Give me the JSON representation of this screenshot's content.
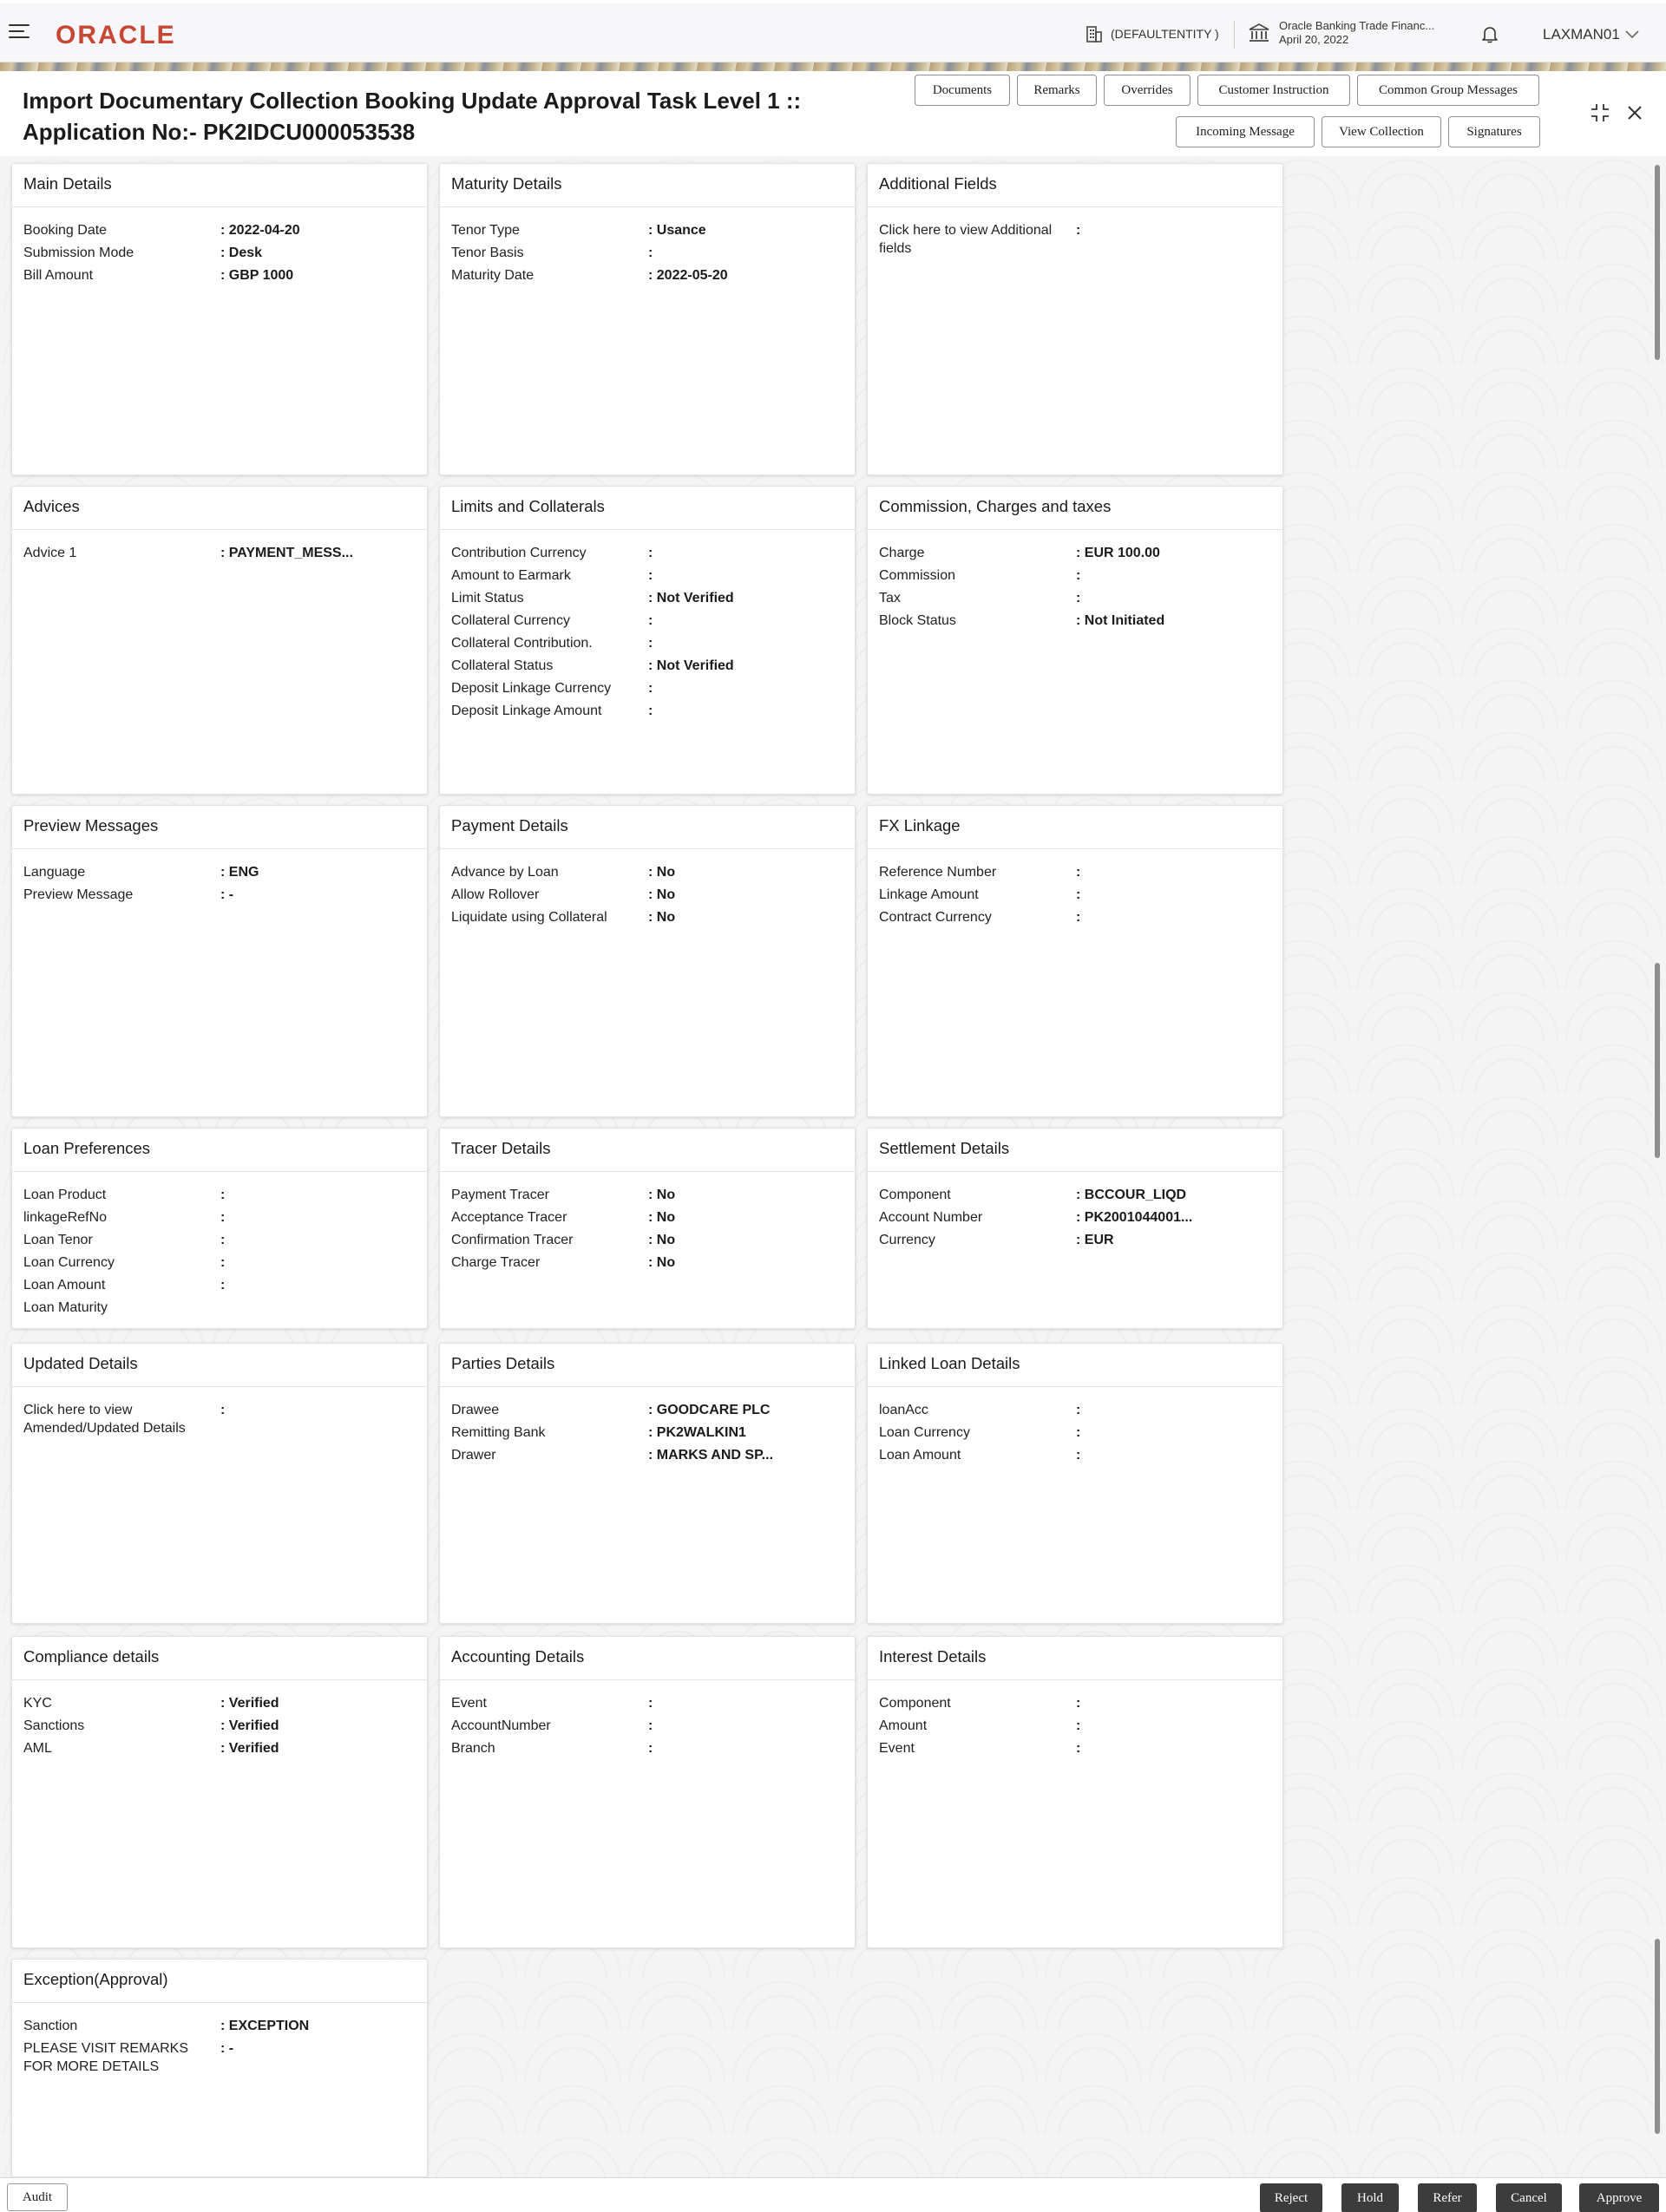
{
  "header": {
    "logo": "ORACLE",
    "entity": "(DEFAULTENTITY )",
    "bank_name": "Oracle Banking Trade Financ...",
    "date": "April 20, 2022",
    "user": "LAXMAN01"
  },
  "title": {
    "line1": "Import Documentary Collection Booking Update Approval Task Level 1 ::",
    "line2": "Application No:- PK2IDCU000053538"
  },
  "toolbar": {
    "documents": "Documents",
    "remarks": "Remarks",
    "overrides": "Overrides",
    "customer_instruction": "Customer Instruction",
    "common_group_messages": "Common Group Messages",
    "incoming_message": "Incoming Message",
    "view_collection": "View Collection",
    "signatures": "Signatures"
  },
  "cards": {
    "main": {
      "title": "Main Details",
      "rows": [
        {
          "label": "Booking Date",
          "value": ": 2022-04-20"
        },
        {
          "label": "Submission Mode",
          "value": ": Desk"
        },
        {
          "label": "Bill Amount",
          "value": ": GBP 1000"
        }
      ]
    },
    "maturity": {
      "title": "Maturity Details",
      "rows": [
        {
          "label": "Tenor Type",
          "value": ": Usance"
        },
        {
          "label": "Tenor Basis",
          "value": ":"
        },
        {
          "label": "Maturity Date",
          "value": ": 2022-05-20"
        }
      ]
    },
    "additional": {
      "title": "Additional Fields",
      "rows": [
        {
          "label": "Click here to view Additional fields",
          "value": ":"
        }
      ]
    },
    "advices": {
      "title": "Advices",
      "rows": [
        {
          "label": "Advice 1",
          "value": ": PAYMENT_MESS..."
        }
      ]
    },
    "limits": {
      "title": "Limits and Collaterals",
      "rows": [
        {
          "label": "Contribution Currency",
          "value": ":"
        },
        {
          "label": "Amount to Earmark",
          "value": ":"
        },
        {
          "label": "Limit Status",
          "value": ": Not Verified"
        },
        {
          "label": "Collateral Currency",
          "value": ":"
        },
        {
          "label": "Collateral Contribution.",
          "value": ":"
        },
        {
          "label": "Collateral Status",
          "value": ": Not Verified"
        },
        {
          "label": "Deposit Linkage Currency",
          "value": ":"
        },
        {
          "label": "Deposit Linkage Amount",
          "value": ":"
        }
      ]
    },
    "commission": {
      "title": "Commission, Charges and taxes",
      "rows": [
        {
          "label": "Charge",
          "value": ": EUR  100.00"
        },
        {
          "label": "Commission",
          "value": ":"
        },
        {
          "label": "Tax",
          "value": ":"
        },
        {
          "label": "Block Status",
          "value": ": Not Initiated"
        }
      ]
    },
    "preview": {
      "title": "Preview Messages",
      "rows": [
        {
          "label": "Language",
          "value": ": ENG"
        },
        {
          "label": "Preview Message",
          "value": ": -"
        }
      ]
    },
    "payment": {
      "title": "Payment Details",
      "rows": [
        {
          "label": "Advance by Loan",
          "value": ": No"
        },
        {
          "label": "Allow Rollover",
          "value": ": No"
        },
        {
          "label": "Liquidate using Collateral",
          "value": ": No"
        }
      ]
    },
    "fx": {
      "title": "FX Linkage",
      "rows": [
        {
          "label": "Reference Number",
          "value": ":"
        },
        {
          "label": "Linkage Amount",
          "value": ":"
        },
        {
          "label": "Contract Currency",
          "value": ":"
        }
      ]
    },
    "loanpref": {
      "title": "Loan Preferences",
      "rows": [
        {
          "label": "Loan Product",
          "value": ":"
        },
        {
          "label": "linkageRefNo",
          "value": ":"
        },
        {
          "label": "Loan Tenor",
          "value": ":"
        },
        {
          "label": "Loan Currency",
          "value": ":"
        },
        {
          "label": "Loan Amount",
          "value": ":"
        },
        {
          "label": "Loan Maturity",
          "value": ""
        }
      ]
    },
    "tracer": {
      "title": "Tracer Details",
      "rows": [
        {
          "label": "Payment Tracer",
          "value": ": No"
        },
        {
          "label": "Acceptance Tracer",
          "value": ": No"
        },
        {
          "label": "Confirmation Tracer",
          "value": ": No"
        },
        {
          "label": "Charge Tracer",
          "value": ": No"
        }
      ]
    },
    "settlement": {
      "title": "Settlement Details",
      "rows": [
        {
          "label": "Component",
          "value": ": BCCOUR_LIQD"
        },
        {
          "label": "Account Number",
          "value": ": PK2001044001..."
        },
        {
          "label": "Currency",
          "value": ": EUR"
        }
      ]
    },
    "updated": {
      "title": "Updated Details",
      "rows": [
        {
          "label": "Click here to view Amended/Updated Details",
          "value": ":"
        }
      ]
    },
    "parties": {
      "title": "Parties Details",
      "rows": [
        {
          "label": "Drawee",
          "value": ": GOODCARE PLC"
        },
        {
          "label": "Remitting Bank",
          "value": ": PK2WALKIN1"
        },
        {
          "label": "Drawer",
          "value": ": MARKS AND SP..."
        }
      ]
    },
    "linkedloan": {
      "title": "Linked Loan Details",
      "rows": [
        {
          "label": "loanAcc",
          "value": ":"
        },
        {
          "label": "Loan Currency",
          "value": ":"
        },
        {
          "label": "Loan Amount",
          "value": ":"
        }
      ]
    },
    "compliance": {
      "title": "Compliance details",
      "rows": [
        {
          "label": "KYC",
          "value": ": Verified"
        },
        {
          "label": "Sanctions",
          "value": ": Verified"
        },
        {
          "label": "AML",
          "value": ": Verified"
        }
      ]
    },
    "accounting": {
      "title": "Accounting Details",
      "rows": [
        {
          "label": "Event",
          "value": ":"
        },
        {
          "label": "AccountNumber",
          "value": ":"
        },
        {
          "label": "Branch",
          "value": ":"
        }
      ]
    },
    "interest": {
      "title": "Interest Details",
      "rows": [
        {
          "label": "Component",
          "value": ":"
        },
        {
          "label": "Amount",
          "value": ":"
        },
        {
          "label": "Event",
          "value": ":"
        }
      ]
    },
    "exception": {
      "title": "Exception(Approval)",
      "rows": [
        {
          "label": "Sanction",
          "value": ": EXCEPTION"
        },
        {
          "label": "PLEASE VISIT REMARKS FOR MORE DETAILS",
          "value": ": -"
        }
      ]
    }
  },
  "footer": {
    "audit": "Audit",
    "reject": "Reject",
    "hold": "Hold",
    "refer": "Refer",
    "cancel": "Cancel",
    "approve": "Approve"
  }
}
